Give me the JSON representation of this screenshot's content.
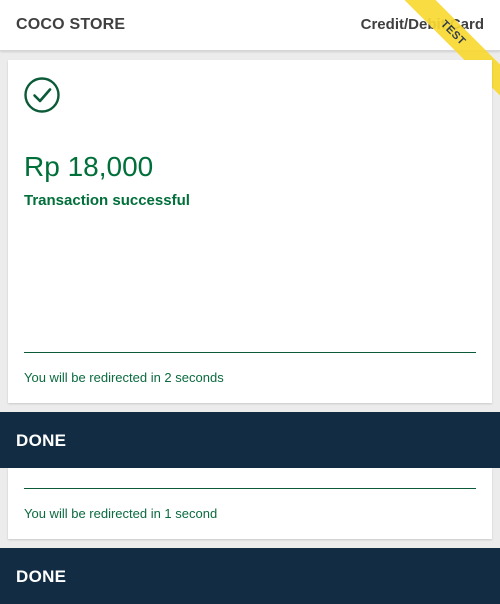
{
  "header": {
    "store_name": "COCO STORE",
    "payment_method": "Credit/Debit Card",
    "ribbon_label": "TEST"
  },
  "card": {
    "status_icon": "check-circle-icon",
    "amount": "Rp 18,000",
    "status_text": "Transaction successful",
    "redirect_text": "You will be redirected in 2 seconds"
  },
  "done_primary": {
    "label": "DONE"
  },
  "card_second": {
    "redirect_text": "You will be redirected in 1 second"
  },
  "done_secondary": {
    "label": "DONE"
  },
  "colors": {
    "success": "#006f3a",
    "button_bg": "#112c43",
    "ribbon": "#f9d932",
    "header_text": "#404040"
  }
}
